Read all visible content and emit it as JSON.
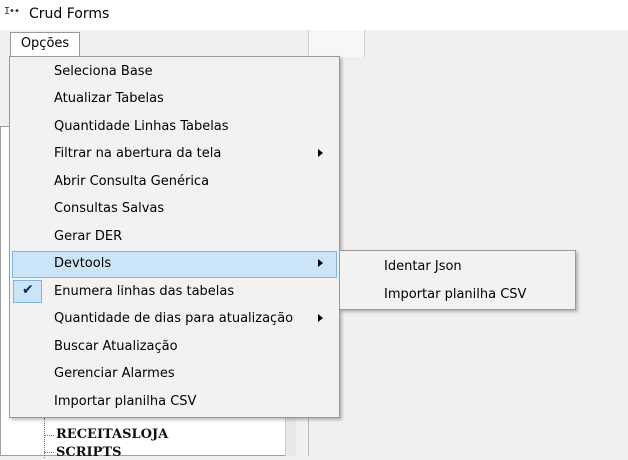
{
  "window": {
    "title": "Crud Forms",
    "icon": "app-icon",
    "icon_glyph": "I••"
  },
  "menubar": {
    "opcoes_label": "Opções"
  },
  "dropdown": {
    "items": [
      {
        "label": "Seleciona Base",
        "submenu": false
      },
      {
        "label": "Atualizar Tabelas",
        "submenu": false
      },
      {
        "label": "Quantidade Linhas Tabelas",
        "submenu": false
      },
      {
        "label": "Filtrar na abertura da tela",
        "submenu": true
      },
      {
        "label": "Abrir Consulta Genérica",
        "submenu": false
      },
      {
        "label": "Consultas Salvas",
        "submenu": false
      },
      {
        "label": "Gerar DER",
        "submenu": false
      },
      {
        "label": "Devtools",
        "submenu": true,
        "highlighted": true
      },
      {
        "label": "Enumera linhas das tabelas",
        "submenu": false,
        "checked": true
      },
      {
        "label": "Quantidade de dias para atualização",
        "submenu": true
      },
      {
        "label": "Buscar Atualização",
        "submenu": false
      },
      {
        "label": "Gerenciar Alarmes",
        "submenu": false
      },
      {
        "label": "Importar planilha CSV",
        "submenu": false
      }
    ],
    "check_glyph": "✔"
  },
  "devtools_submenu": {
    "items": [
      {
        "label": "Identar Json"
      },
      {
        "label": "Importar planilha CSV"
      }
    ]
  },
  "tree": {
    "nodes": [
      {
        "label": "RECEITASLOJA"
      },
      {
        "label": "SCRIPTS"
      }
    ]
  },
  "colors": {
    "highlight_bg": "#cce4f7",
    "highlight_border": "#7fb4e4",
    "menu_bg": "#f2f2f2"
  }
}
